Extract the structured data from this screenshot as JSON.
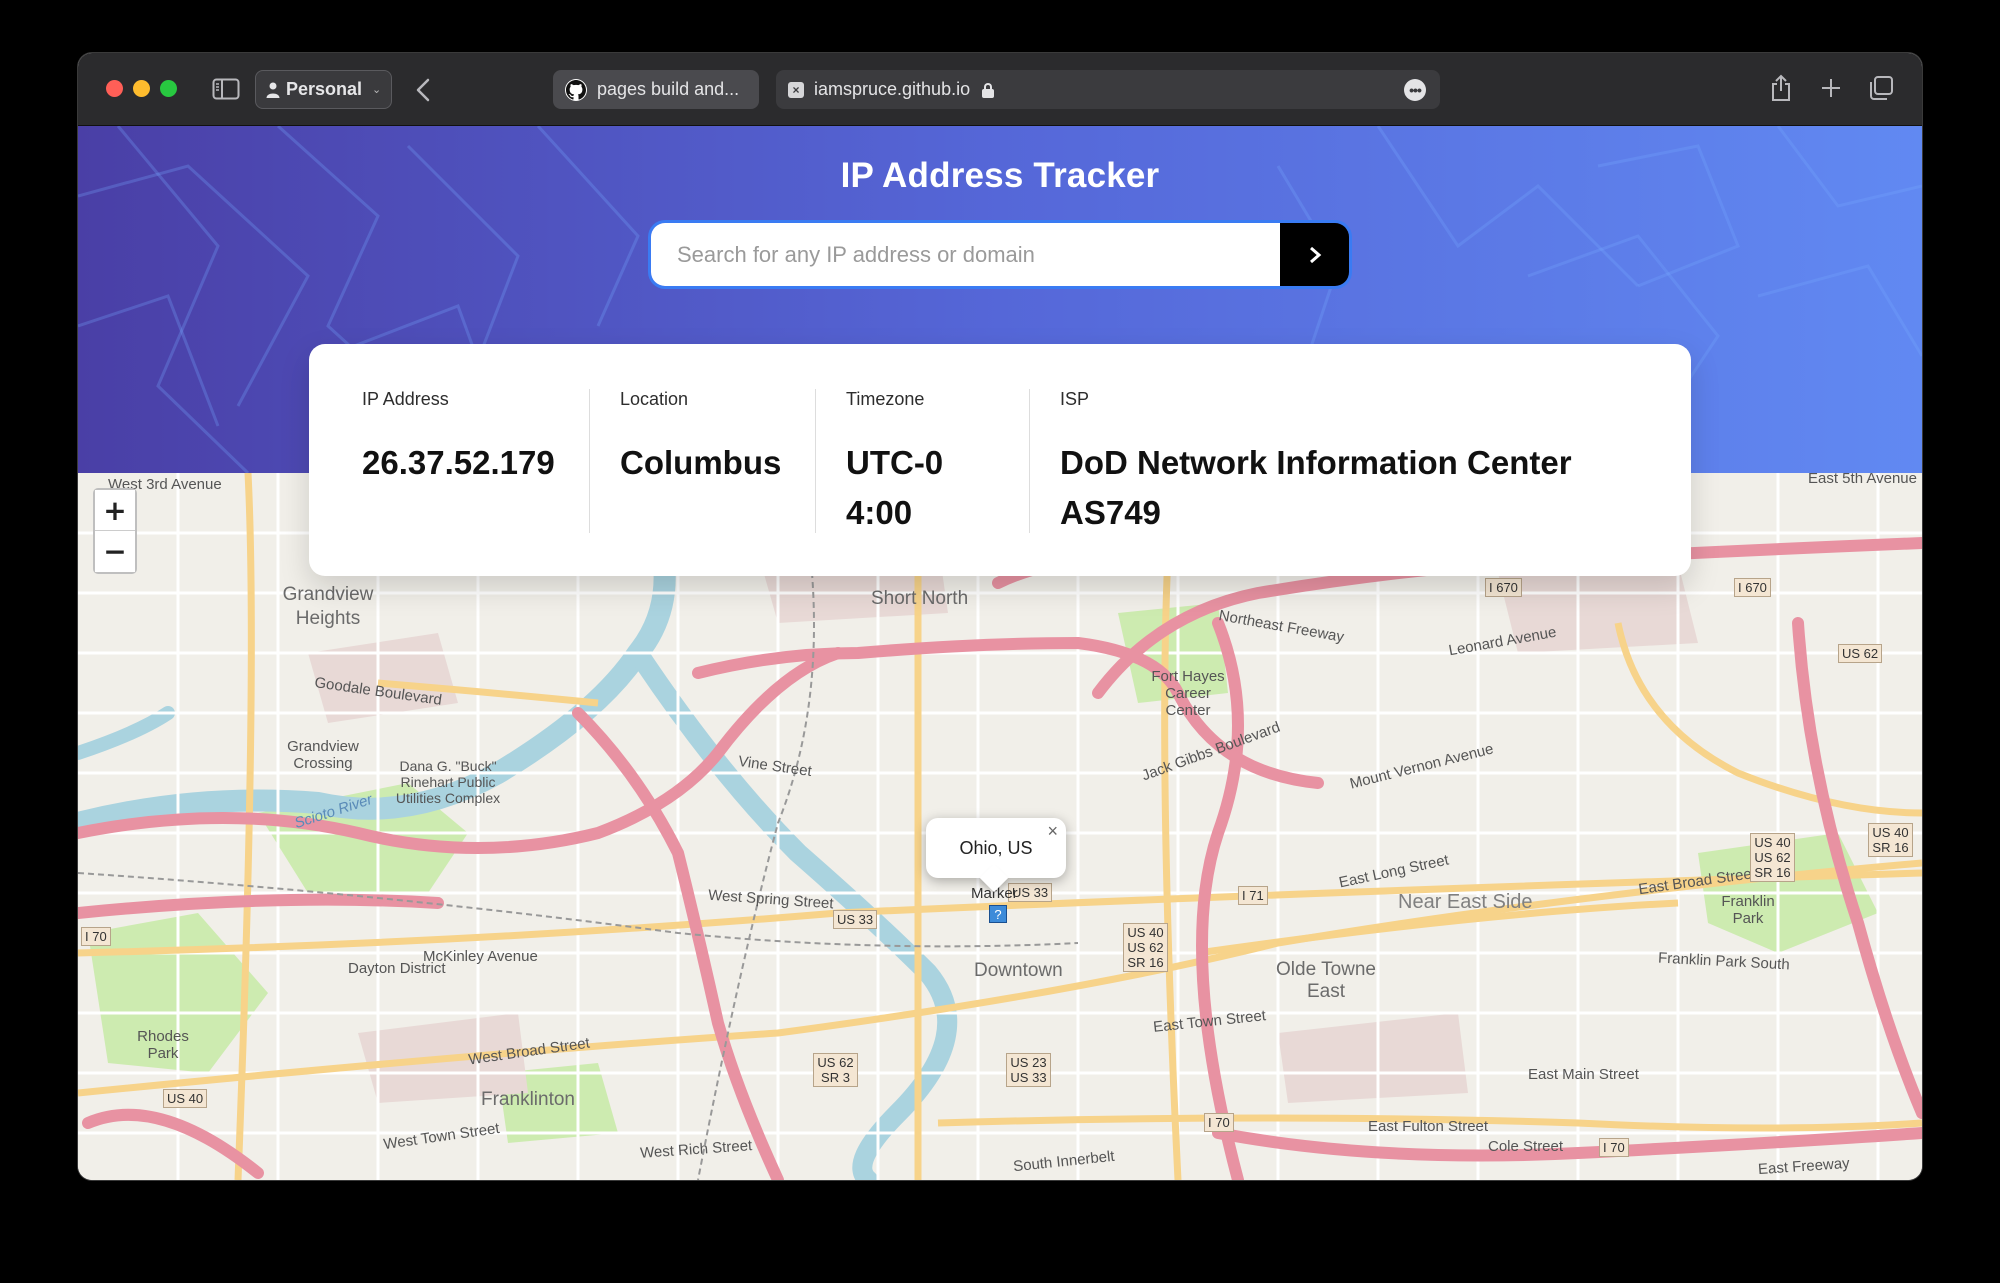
{
  "browser": {
    "profile_label": "Personal",
    "tabs": [
      {
        "title": "pages build and..."
      },
      {
        "title": "iamspruce.github.io"
      }
    ]
  },
  "app": {
    "title": "IP Address Tracker",
    "search": {
      "placeholder": "Search for any IP address or domain",
      "value": ""
    }
  },
  "stats": [
    {
      "label": "IP Address",
      "value": "26.37.52.179"
    },
    {
      "label": "Location",
      "value": "Columbus"
    },
    {
      "label": "Timezone",
      "value": "UTC-04:00"
    },
    {
      "label": "ISP",
      "value": "DoD Network Information Center AS749"
    }
  ],
  "map": {
    "zoom_in_label": "+",
    "zoom_out_label": "−",
    "popup_text": "Ohio, US",
    "marker_text": "Marker",
    "labels": {
      "grandview_heights": "Grandview Heights",
      "grandview_crossing": "Grandview Crossing",
      "short_north": "Short North",
      "fort_hayes": "Fort Hayes Career Center",
      "downtown": "Downtown",
      "near_east_side": "Near East Side",
      "olde_towne_east": "Olde Towne East",
      "franklinton": "Franklinton",
      "dayton_district": "Dayton District",
      "rhodes_park": "Rhodes Park",
      "franklin_park": "Franklin Park",
      "dana_rinehart": "Dana G. \"Buck\" Rinehart Public Utilities Complex",
      "west_broad_street": "West Broad Street",
      "east_broad_street": "East Broad Street",
      "east_long_street": "East Long Street",
      "mount_vernon_avenue": "Mount Vernon Avenue",
      "jack_gibbs_boulevard": "Jack Gibbs Boulevard",
      "goodale_boulevard": "Goodale Boulevard",
      "mckinley_avenue": "McKinley Avenue",
      "east_main_street": "East Main Street",
      "west_spring_street": "West Spring Street",
      "east_town_street": "East Town Street",
      "west_town_street": "West Town Street",
      "east_fulton_street": "East Fulton Street",
      "south_innerbelt": "South Innerbelt",
      "cole_street": "Cole Street",
      "east_freeway": "East Freeway",
      "northeast_freeway": "Northeast Freeway",
      "leonard_avenue": "Leonard Avenue",
      "west_3rd_avenue": "West 3rd Avenue",
      "east_5th_avenue": "East 5th Avenue",
      "scioto_river": "Scioto River",
      "vine_street": "Vine Street",
      "franklin_park_south": "Franklin Park South",
      "west_rich_street": "West Rich Street"
    },
    "shields": [
      "I 670",
      "I 670",
      "US 62",
      "I 71",
      "US 33",
      "US 33",
      "US 40 US 62 SR 16",
      "US 40 US 62 SR 16",
      "US 40 SR 16",
      "I 70",
      "US 40",
      "US 62 SR 3",
      "US 23 US 33",
      "I 70",
      "I 70"
    ]
  }
}
